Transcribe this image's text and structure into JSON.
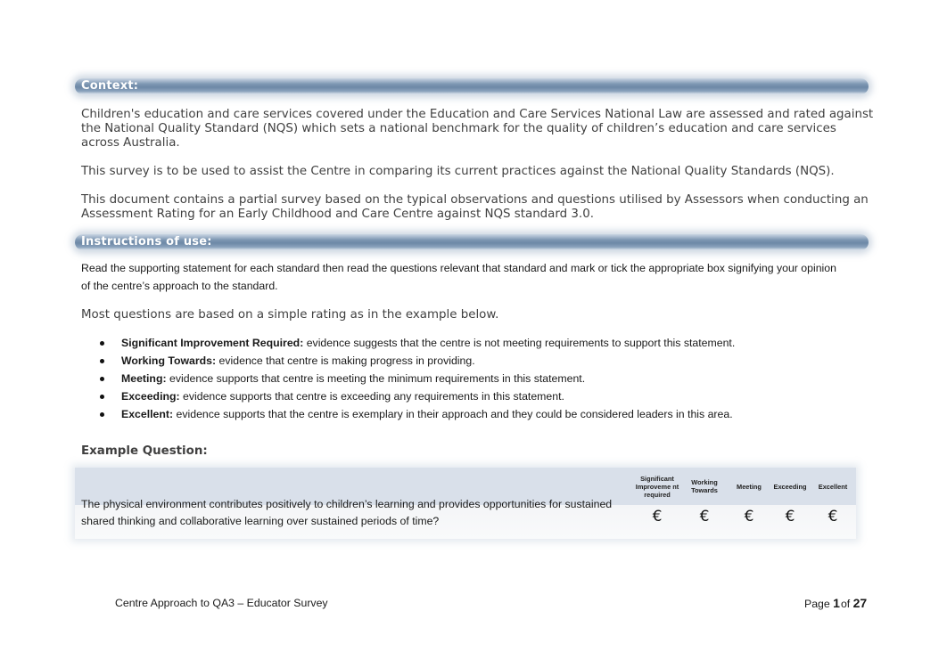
{
  "context": {
    "heading": "Context:",
    "paragraphs": [
      "Children's education and care services covered under the Education and Care Services National Law are assessed and rated against the National Quality Standard (NQS) which sets a national benchmark for the quality of children’s education and care services across Australia.",
      "This survey is to be used to assist the Centre in comparing its current practices against the National Quality Standards (NQS).",
      "This document contains a partial survey based on the typical observations and questions utilised by Assessors when conducting an Assessment Rating for an Early Childhood and Care Centre against NQS standard 3.0."
    ]
  },
  "instructions": {
    "heading": "Instructions of use:",
    "text": "Read the supporting statement for each standard then read the questions relevant that standard and mark or tick the appropriate box signifying your opinion of the centre’s approach to the standard.",
    "rating_intro": "Most questions are based on a simple rating as in the example below.",
    "ratings": [
      {
        "term": "Significant Improvement Required:",
        "desc": " evidence suggests that the centre is not meeting requirements to support this statement."
      },
      {
        "term": "Working Towards:",
        "desc": " evidence that centre is making progress in providing."
      },
      {
        "term": "Meeting:",
        "desc": " evidence supports that centre is meeting the minimum requirements in this statement."
      },
      {
        "term": "Exceeding:",
        "desc": " evidence supports that centre is exceeding any requirements in this statement."
      },
      {
        "term": "Excellent:",
        "desc": " evidence supports that the centre is exemplary in their approach and they could be considered leaders in this area."
      }
    ]
  },
  "example": {
    "label": "Example Question:",
    "question": "The physical environment contributes positively to children’s learning and provides opportunities for sustained shared thinking and collaborative learning over sustained periods of time?",
    "columns": [
      "Significant Improveme nt required",
      "Working Towards",
      "Meeting",
      "Exceeding",
      "Excellent"
    ],
    "option_glyph": "€"
  },
  "footer": {
    "title": "Centre Approach to QA3 – Educator Survey",
    "page_label": "Page",
    "page_current": "1",
    "page_of": "of",
    "page_total": "27"
  }
}
